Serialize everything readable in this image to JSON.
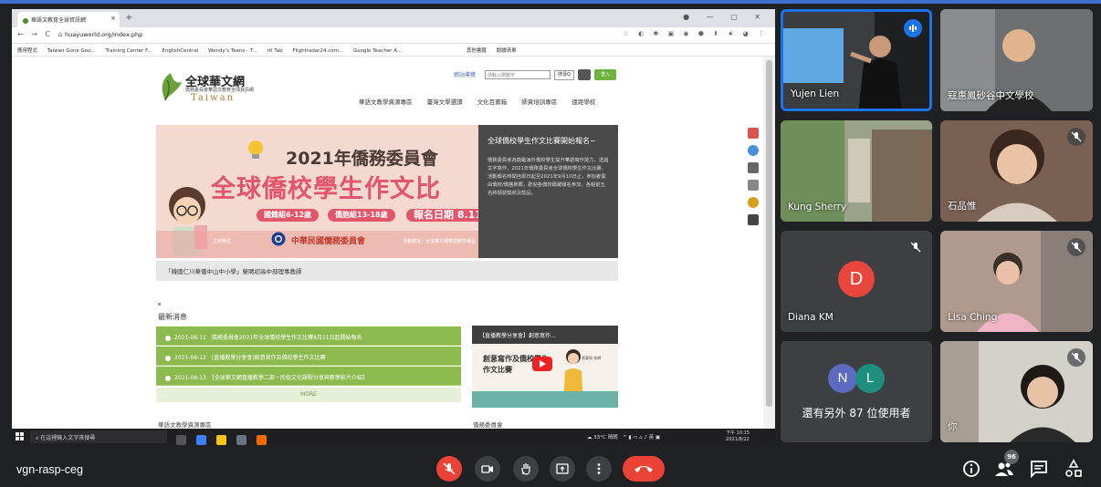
{
  "browser": {
    "tab_title": "華語文教育全球資訊網",
    "url": "huayuworld.org/index.php",
    "bookmarks": [
      "應用程式",
      "Taiwan Gone Goo...",
      "Training Center F...",
      "EnglishCentral",
      "Wendy's Teens - T...",
      "rtl Tab",
      "Flightradar24.com...",
      "Google Teacher A...",
      "其他書籤",
      "閱讀清單"
    ]
  },
  "site": {
    "logo_title": "全球華文網",
    "logo_sub": "僑務委員會華語文教育全球資訊網",
    "logo_en": "Taiwan",
    "search_label": "網站導覽",
    "search_placeholder": "請輸入關鍵字",
    "search_button": "搜尋Q",
    "login_button": "登入",
    "nav": [
      "華語文教學資源專區",
      "臺灣文學選讀",
      "文化百寶箱",
      "師資培訓專區",
      "遠距學校"
    ],
    "banner": {
      "line1": "2021年僑務委員會",
      "line2": "全球僑校學生作文比",
      "pill1": "國籍組6-12歲",
      "pill2": "僑胞組13-18歲",
      "pill3": "報名日期 8.11-9.",
      "org": "中華民國僑務委員會",
      "left_note": "主辦單位",
      "right_note": "活動網址：全球華文網華語教學專區"
    },
    "info_box": {
      "title": "全球僑校學生作文比賽開始報名~",
      "text": "僑務委員會為鼓勵海外僑校學生提升華語寫作能力，透過文字寫作，2021年僑務委員會全球僑校學生作文比賽，活動報名時間自即日起至2021年9月10日止，參加者需由僑校/僑團推薦，歡迎各僑校踴躍報名參加，各組前五名將頒發獎狀及獎品。"
    },
    "caption": "「韓國仁川華僑中山中小學」榮聘初高中部理事教師",
    "news_title": "最新消息",
    "news": [
      {
        "date": "2021-08-11",
        "text": "僑務委員會2021年全球僑校學生作文比賽8月11日起開始報名"
      },
      {
        "date": "2021-08-12",
        "text": "[直播教學分享會]創意寫作及僑校學生作文比賽"
      },
      {
        "date": "2021-08-13",
        "text": "【全球華文網直播教學二部－民俗文化課程分享與教學影片介紹】"
      }
    ],
    "more": "MORE",
    "video": {
      "bar": "【直播教學分享會】創意寫作...",
      "title1": "創意寫作及僑校學生",
      "title2": "作文比賽",
      "presenter": "張惠如 老師"
    },
    "bottom_left": "華語文教學資源專區",
    "bottom_right": "僑務委員會"
  },
  "taskbar": {
    "search": "在這裡輸入文字來搜尋",
    "weather": "33°C 晴朗",
    "time": "下午 10:15",
    "date": "2021/8/22"
  },
  "participants": [
    {
      "name": "Yujen Lien",
      "speaking": true
    },
    {
      "name": "寇惠鳳砂谷中文學校"
    },
    {
      "name": "Kung Sherry"
    },
    {
      "name": "石品惟",
      "muted": true
    },
    {
      "name": "Diana KM",
      "initial": "D",
      "muted": true
    },
    {
      "name": "Lisa Ching",
      "muted": true
    },
    {
      "name": "還有另外 87 位使用者",
      "initials": [
        "N",
        "L"
      ]
    },
    {
      "name": "你",
      "muted": true
    }
  ],
  "meeting": {
    "code": "vgn-rasp-ceg",
    "participant_count": "96"
  },
  "colors": {
    "meet_bg": "#202124",
    "end_red": "#ea4335",
    "speaking_blue": "#1a73e8",
    "site_green": "#8cba4f"
  }
}
